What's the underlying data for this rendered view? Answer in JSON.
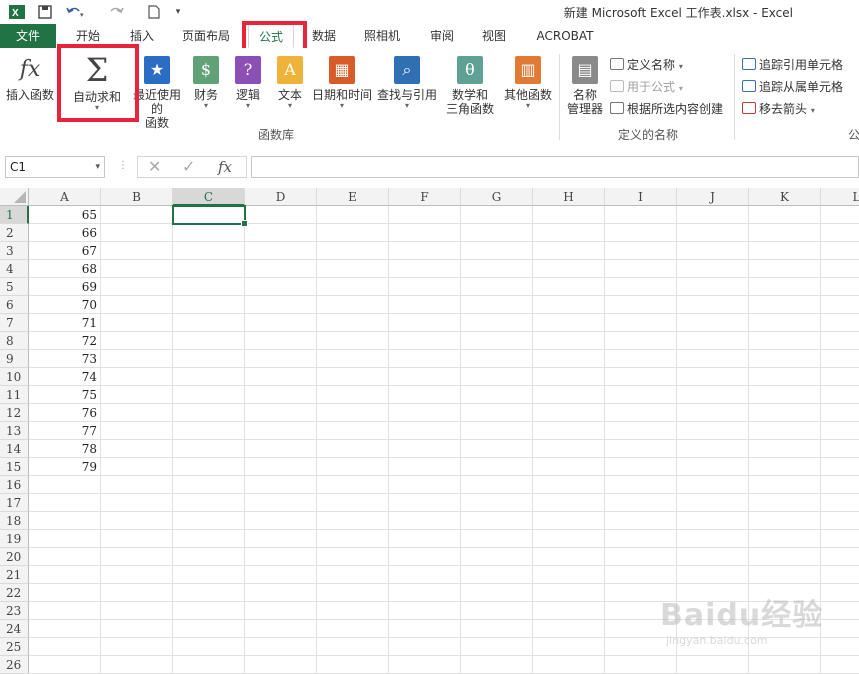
{
  "window": {
    "title": "新建 Microsoft Excel 工作表.xlsx - Excel"
  },
  "qat": {
    "excel_icon": "excel-logo-icon",
    "save": "save-icon",
    "undo": "undo-icon",
    "redo": "redo-icon",
    "new": "new-file-icon"
  },
  "tabs": [
    {
      "label": "文件"
    },
    {
      "label": "开始"
    },
    {
      "label": "插入"
    },
    {
      "label": "页面布局"
    },
    {
      "label": "公式"
    },
    {
      "label": "数据"
    },
    {
      "label": "照相机"
    },
    {
      "label": "审阅"
    },
    {
      "label": "视图"
    },
    {
      "label": "ACROBAT"
    }
  ],
  "ribbon": {
    "function_library": {
      "group_label": "函数库",
      "insert_function": "插入函数",
      "autosum": "自动求和",
      "recent_1": "最近使用的",
      "recent_2": "函数",
      "financial": "财务",
      "logical": "逻辑",
      "text": "文本",
      "datetime": "日期和时间",
      "lookup": "查找与引用",
      "math_1": "数学和",
      "math_2": "三角函数",
      "more": "其他函数"
    },
    "defined_names": {
      "group_label": "定义的名称",
      "name_manager_1": "名称",
      "name_manager_2": "管理器",
      "define_name": "定义名称",
      "use_in_formula": "用于公式",
      "create_from_selection": "根据所选内容创建"
    },
    "formula_auditing": {
      "trace_precedents": "追踪引用单元格",
      "trace_dependents": "追踪从属单元格",
      "remove_arrows": "移去箭头",
      "group_label_partial": "公"
    }
  },
  "formula_bar": {
    "name_box": "C1",
    "formula": ""
  },
  "grid": {
    "columns": [
      "A",
      "B",
      "C",
      "D",
      "E",
      "F",
      "G",
      "H",
      "I",
      "J",
      "K",
      "L"
    ],
    "rows": [
      "1",
      "2",
      "3",
      "4",
      "5",
      "6",
      "7",
      "8",
      "9",
      "10",
      "11",
      "12",
      "13",
      "14",
      "15",
      "16",
      "17",
      "18",
      "19",
      "20",
      "21",
      "22",
      "23",
      "24",
      "25",
      "26"
    ],
    "column_a_values": [
      "65",
      "66",
      "67",
      "68",
      "69",
      "70",
      "71",
      "72",
      "73",
      "74",
      "75",
      "76",
      "77",
      "78",
      "79"
    ],
    "selected_cell": "C1"
  },
  "watermark": {
    "line1": "Baidu经验",
    "line2": "jingyan.baidu.com"
  },
  "colors": {
    "excel_green": "#217346",
    "highlight_red": "#e8233a"
  }
}
